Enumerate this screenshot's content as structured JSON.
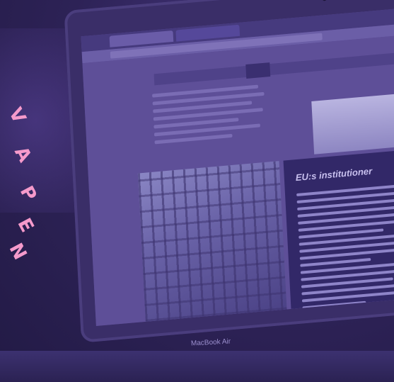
{
  "brand": {
    "letters": [
      "V",
      "A",
      "P",
      "E",
      "N"
    ],
    "color": "#f59acb"
  },
  "screen": {
    "panel_title": "EU:s institutioner"
  },
  "laptop": {
    "model_label": "MacBook Air"
  },
  "colors": {
    "overlay": "#2e2256",
    "accent": "#f59acb"
  }
}
